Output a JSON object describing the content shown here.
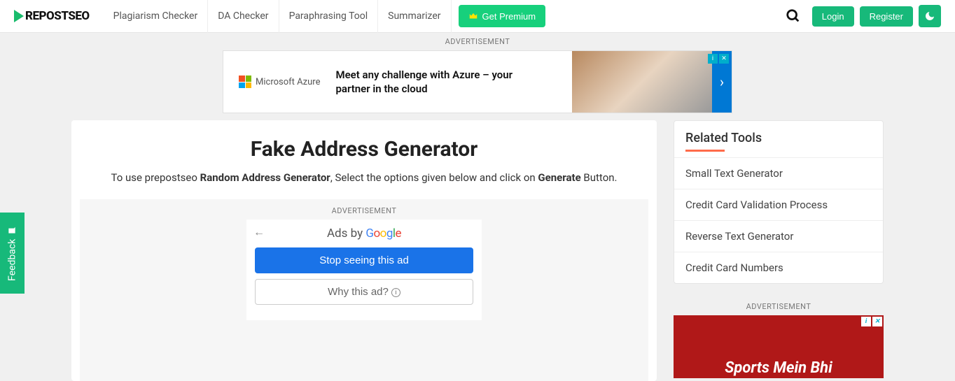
{
  "header": {
    "logo_text": "REPOSTSEO",
    "nav": [
      "Plagiarism Checker",
      "DA Checker",
      "Paraphrasing Tool",
      "Summarizer"
    ],
    "premium_label": "Get Premium",
    "login_label": "Login",
    "register_label": "Register"
  },
  "ads": {
    "label": "ADVERTISEMENT",
    "azure_brand": "Microsoft Azure",
    "azure_text": "Meet any challenge with Azure – your partner in the cloud",
    "google_prefix": "Ads by ",
    "stop_label": "Stop seeing this ad",
    "why_label": "Why this ad?",
    "side_text": "Sports Mein Bhi"
  },
  "page": {
    "title": "Fake Address Generator",
    "sub_pre": "To use prepostseo ",
    "sub_bold1": "Random Address Generator",
    "sub_mid": ", Select the options given below and click on ",
    "sub_bold2": "Generate",
    "sub_post": " Button."
  },
  "sidebar": {
    "title": "Related Tools",
    "items": [
      "Small Text Generator",
      "Credit Card Validation Process",
      "Reverse Text Generator",
      "Credit Card Numbers"
    ]
  },
  "feedback_label": "Feedback"
}
